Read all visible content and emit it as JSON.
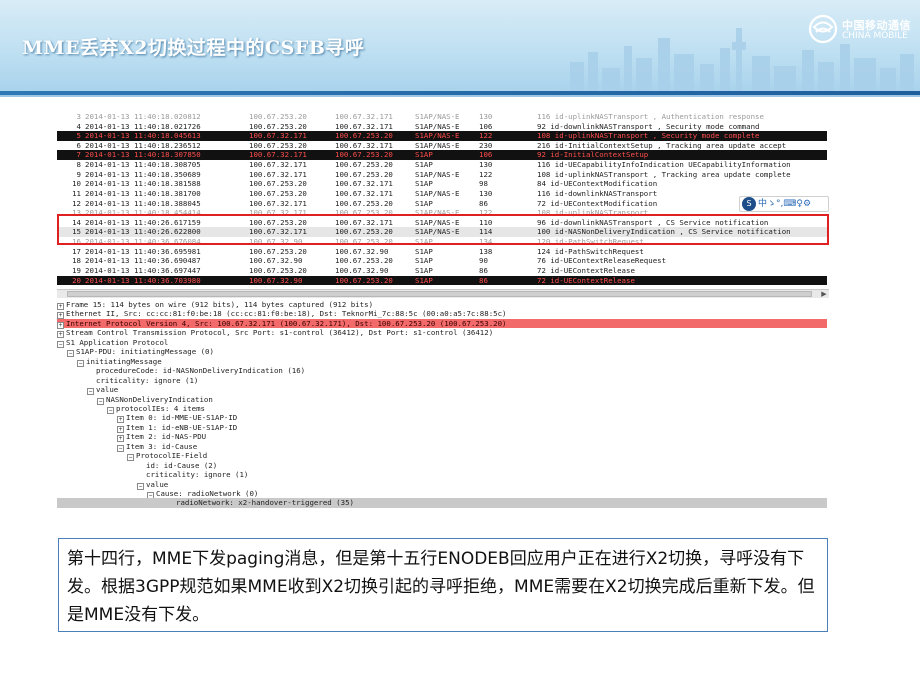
{
  "header": {
    "title": "MME丢弃X2切换过程中的CSFB寻呼",
    "brand_cn": "中国移动通信",
    "brand_en": "CHINA MOBILE"
  },
  "packet_list": {
    "rows": [
      {
        "no": "3",
        "time": "2014-01-13 11:40:18.020812",
        "src": "100.67.253.20",
        "dst": "100.67.32.171",
        "proto": "S1AP/NAS-E",
        "len": "130",
        "info": "116 id-uplinkNASTransport , Authentication response",
        "style": "cut"
      },
      {
        "no": "4",
        "time": "2014-01-13 11:40:18.021726",
        "src": "100.67.253.20",
        "dst": "100.67.32.171",
        "proto": "S1AP/NAS-E",
        "len": "106",
        "info": "92 id-downlinkNASTransport , Security mode command",
        "style": "normal"
      },
      {
        "no": "5",
        "time": "2014-01-13 11:40:18.045613",
        "src": "100.67.32.171",
        "dst": "100.67.253.20",
        "proto": "S1AP/NAS-E",
        "len": "122",
        "info": "108 id-uplinkNASTransport , Security mode complete",
        "style": "dark"
      },
      {
        "no": "6",
        "time": "2014-01-13 11:40:18.236512",
        "src": "100.67.253.20",
        "dst": "100.67.32.171",
        "proto": "S1AP/NAS-E",
        "len": "230",
        "info": "216 id-InitialContextSetup , Tracking area update accept",
        "style": "normal"
      },
      {
        "no": "7",
        "time": "2014-01-13 11:40:18.307850",
        "src": "100.67.32.171",
        "dst": "100.67.253.20",
        "proto": "S1AP",
        "len": "106",
        "info": "92 id-InitialContextSetup",
        "style": "dark"
      },
      {
        "no": "8",
        "time": "2014-01-13 11:40:18.308705",
        "src": "100.67.32.171",
        "dst": "100.67.253.20",
        "proto": "S1AP",
        "len": "130",
        "info": "116 id-UECapabilityInfoIndication UECapabilityInformation",
        "style": "normal"
      },
      {
        "no": "9",
        "time": "2014-01-13 11:40:18.350689",
        "src": "100.67.32.171",
        "dst": "100.67.253.20",
        "proto": "S1AP/NAS-E",
        "len": "122",
        "info": "108 id-uplinkNASTransport , Tracking area update complete",
        "style": "normal"
      },
      {
        "no": "10",
        "time": "2014-01-13 11:40:18.381588",
        "src": "100.67.253.20",
        "dst": "100.67.32.171",
        "proto": "S1AP",
        "len": "98",
        "info": "84 id-UEContextModification",
        "style": "normal"
      },
      {
        "no": "11",
        "time": "2014-01-13 11:40:18.381700",
        "src": "100.67.253.20",
        "dst": "100.67.32.171",
        "proto": "S1AP/NAS-E",
        "len": "130",
        "info": "116 id-downlinkNASTransport",
        "style": "normal"
      },
      {
        "no": "12",
        "time": "2014-01-13 11:40:18.388045",
        "src": "100.67.32.171",
        "dst": "100.67.253.20",
        "proto": "S1AP",
        "len": "86",
        "info": "72 id-UEContextModification",
        "style": "normal"
      },
      {
        "no": "13",
        "time": "2014-01-13 11:40:18.454414",
        "src": "100.67.32.171",
        "dst": "100.67.253.20",
        "proto": "S1AP/NAS-E",
        "len": "122",
        "info": "108 id-uplinkNASTransport",
        "style": "cut"
      },
      {
        "no": "14",
        "time": "2014-01-13 11:40:26.617159",
        "src": "100.67.253.20",
        "dst": "100.67.32.171",
        "proto": "S1AP/NAS-E",
        "len": "110",
        "info": "96 id-downlinkNASTransport , CS Service notification",
        "style": "normal"
      },
      {
        "no": "15",
        "time": "2014-01-13 11:40:26.622800",
        "src": "100.67.32.171",
        "dst": "100.67.253.20",
        "proto": "S1AP/NAS-E",
        "len": "114",
        "info": "100 id-NASNonDeliveryIndication , CS Service notification",
        "style": "sel"
      },
      {
        "no": "16",
        "time": "2014-01-13 11:40:36.676084",
        "src": "100.67.32.90",
        "dst": "100.67.253.20",
        "proto": "S1AP",
        "len": "134",
        "info": "120 id-PathSwitchRequest",
        "style": "cut"
      },
      {
        "no": "17",
        "time": "2014-01-13 11:40:36.695981",
        "src": "100.67.253.20",
        "dst": "100.67.32.90",
        "proto": "S1AP",
        "len": "138",
        "info": "124 id-PathSwitchRequest",
        "style": "normal"
      },
      {
        "no": "18",
        "time": "2014-01-13 11:40:36.690487",
        "src": "100.67.32.90",
        "dst": "100.67.253.20",
        "proto": "S1AP",
        "len": "90",
        "info": "76 id-UEContextReleaseRequest",
        "style": "normal"
      },
      {
        "no": "19",
        "time": "2014-01-13 11:40:36.697447",
        "src": "100.67.253.20",
        "dst": "100.67.32.90",
        "proto": "S1AP",
        "len": "86",
        "info": "72 id-UEContextRelease",
        "style": "normal"
      },
      {
        "no": "20",
        "time": "2014-01-13 11:40:36.703980",
        "src": "100.67.32.90",
        "dst": "100.67.253.20",
        "proto": "S1AP",
        "len": "86",
        "info": "72 id-UEContextRelease",
        "style": "dark"
      }
    ]
  },
  "ime": {
    "label": "中ゝ°,⌨♀⚙"
  },
  "detail": {
    "rows": [
      {
        "text": "Frame 15: 114 bytes on wire (912 bits), 114 bytes captured (912 bits)",
        "exp": "+",
        "level": 0,
        "style": "normal"
      },
      {
        "text": "Ethernet II, Src: cc:cc:81:f0:be:18 (cc:cc:81:f0:be:18), Dst: TeknorMi_7c:88:5c (00:a0:a5:7c:88:5c)",
        "exp": "+",
        "level": 0,
        "style": "normal"
      },
      {
        "text": "Internet Protocol Version 4, Src: 100.67.32.171 (100.67.32.171), Dst: 100.67.253.20 (100.67.253.20)",
        "exp": "+",
        "level": 0,
        "style": "red"
      },
      {
        "text": "Stream Control Transmission Protocol, Src Port: s1-control (36412), Dst Port: s1-control (36412)",
        "exp": "+",
        "level": 0,
        "style": "normal"
      },
      {
        "text": "S1 Application Protocol",
        "exp": "-",
        "level": 0,
        "style": "normal"
      },
      {
        "text": "S1AP-PDU: initiatingMessage (0)",
        "exp": "-",
        "level": 1,
        "style": "normal"
      },
      {
        "text": "initiatingMessage",
        "exp": "-",
        "level": 2,
        "style": "normal"
      },
      {
        "text": "procedureCode: id-NASNonDeliveryIndication (16)",
        "exp": "",
        "level": 3,
        "style": "normal"
      },
      {
        "text": "criticality: ignore (1)",
        "exp": "",
        "level": 3,
        "style": "normal"
      },
      {
        "text": "value",
        "exp": "-",
        "level": 3,
        "style": "normal"
      },
      {
        "text": "NASNonDeliveryIndication",
        "exp": "-",
        "level": 4,
        "style": "normal"
      },
      {
        "text": "protocolIEs: 4 items",
        "exp": "-",
        "level": 5,
        "style": "normal"
      },
      {
        "text": "Item 0: id-MME-UE-S1AP-ID",
        "exp": "+",
        "level": 6,
        "style": "normal"
      },
      {
        "text": "Item 1: id-eNB-UE-S1AP-ID",
        "exp": "+",
        "level": 6,
        "style": "normal"
      },
      {
        "text": "Item 2: id-NAS-PDU",
        "exp": "+",
        "level": 6,
        "style": "normal"
      },
      {
        "text": "Item 3: id-Cause",
        "exp": "-",
        "level": 6,
        "style": "normal"
      },
      {
        "text": "ProtocolIE-Field",
        "exp": "-",
        "level": 7,
        "style": "normal"
      },
      {
        "text": "id: id-Cause (2)",
        "exp": "",
        "level": 8,
        "style": "normal"
      },
      {
        "text": "criticality: ignore (1)",
        "exp": "",
        "level": 8,
        "style": "normal"
      },
      {
        "text": "value",
        "exp": "-",
        "level": 8,
        "style": "normal"
      },
      {
        "text": "Cause: radioNetwork (0)",
        "exp": "-",
        "level": 9,
        "style": "normal"
      },
      {
        "text": "radioNetwork: x2-handover-triggered (35)",
        "exp": "",
        "level": 11,
        "style": "sel"
      }
    ]
  },
  "caption": {
    "text": "第十四行，MME下发paging消息，但是第十五行ENODEB回应用户正在进行X2切换，寻呼没有下发。根据3GPP规范如果MME收到X2切换引起的寻呼拒绝，MME需要在X2切换完成后重新下发。但是MME没有下发。"
  }
}
